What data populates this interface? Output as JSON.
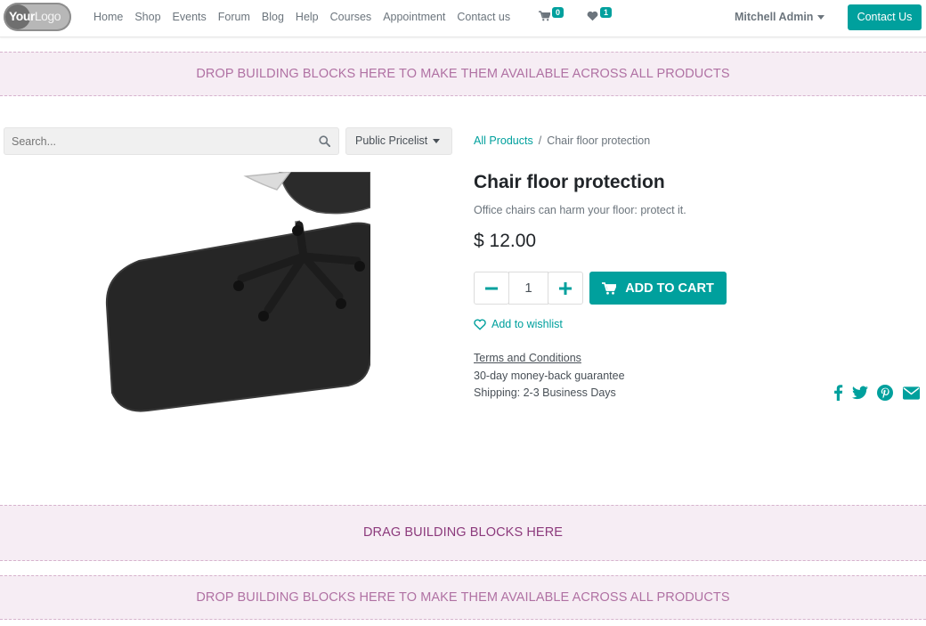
{
  "header": {
    "logo_text_1": "Your",
    "logo_text_2": "Logo",
    "nav": [
      "Home",
      "Shop",
      "Events",
      "Forum",
      "Blog",
      "Help",
      "Courses",
      "Appointment",
      "Contact us"
    ],
    "cart_count": "0",
    "wishlist_count": "1",
    "user": "Mitchell Admin",
    "contact_button": "Contact Us"
  },
  "dropzones": {
    "top": "DROP BUILDING BLOCKS HERE TO MAKE THEM AVAILABLE ACROSS ALL PRODUCTS",
    "middle": "DRAG BUILDING BLOCKS HERE",
    "bottom": "DROP BUILDING BLOCKS HERE TO MAKE THEM AVAILABLE ACROSS ALL PRODUCTS"
  },
  "search": {
    "placeholder": "Search...",
    "pricelist": "Public Pricelist"
  },
  "breadcrumb": {
    "parent": "All Products",
    "separator": "/",
    "current": "Chair floor protection"
  },
  "product": {
    "name": "Chair floor protection",
    "description": "Office chairs can harm your floor: protect it.",
    "currency": "$",
    "price": "12.00",
    "quantity": "1",
    "add_to_cart": "ADD TO CART",
    "add_to_wishlist": "Add to wishlist",
    "terms": "Terms and Conditions",
    "guarantee": "30-day money-back guarantee",
    "shipping": "Shipping: 2-3 Business Days"
  },
  "icons": {
    "cart": "shopping-cart-icon",
    "wishlist": "heart-icon",
    "search": "search-icon",
    "minus": "minus-icon",
    "plus": "plus-icon",
    "facebook": "facebook-icon",
    "twitter": "twitter-icon",
    "pinterest": "pinterest-icon",
    "email": "envelope-icon"
  },
  "colors": {
    "primary": "#00a09d",
    "dropzone_bg": "#f6edf4",
    "dropzone_text": "#b071a3",
    "text_muted": "#6c757d"
  }
}
